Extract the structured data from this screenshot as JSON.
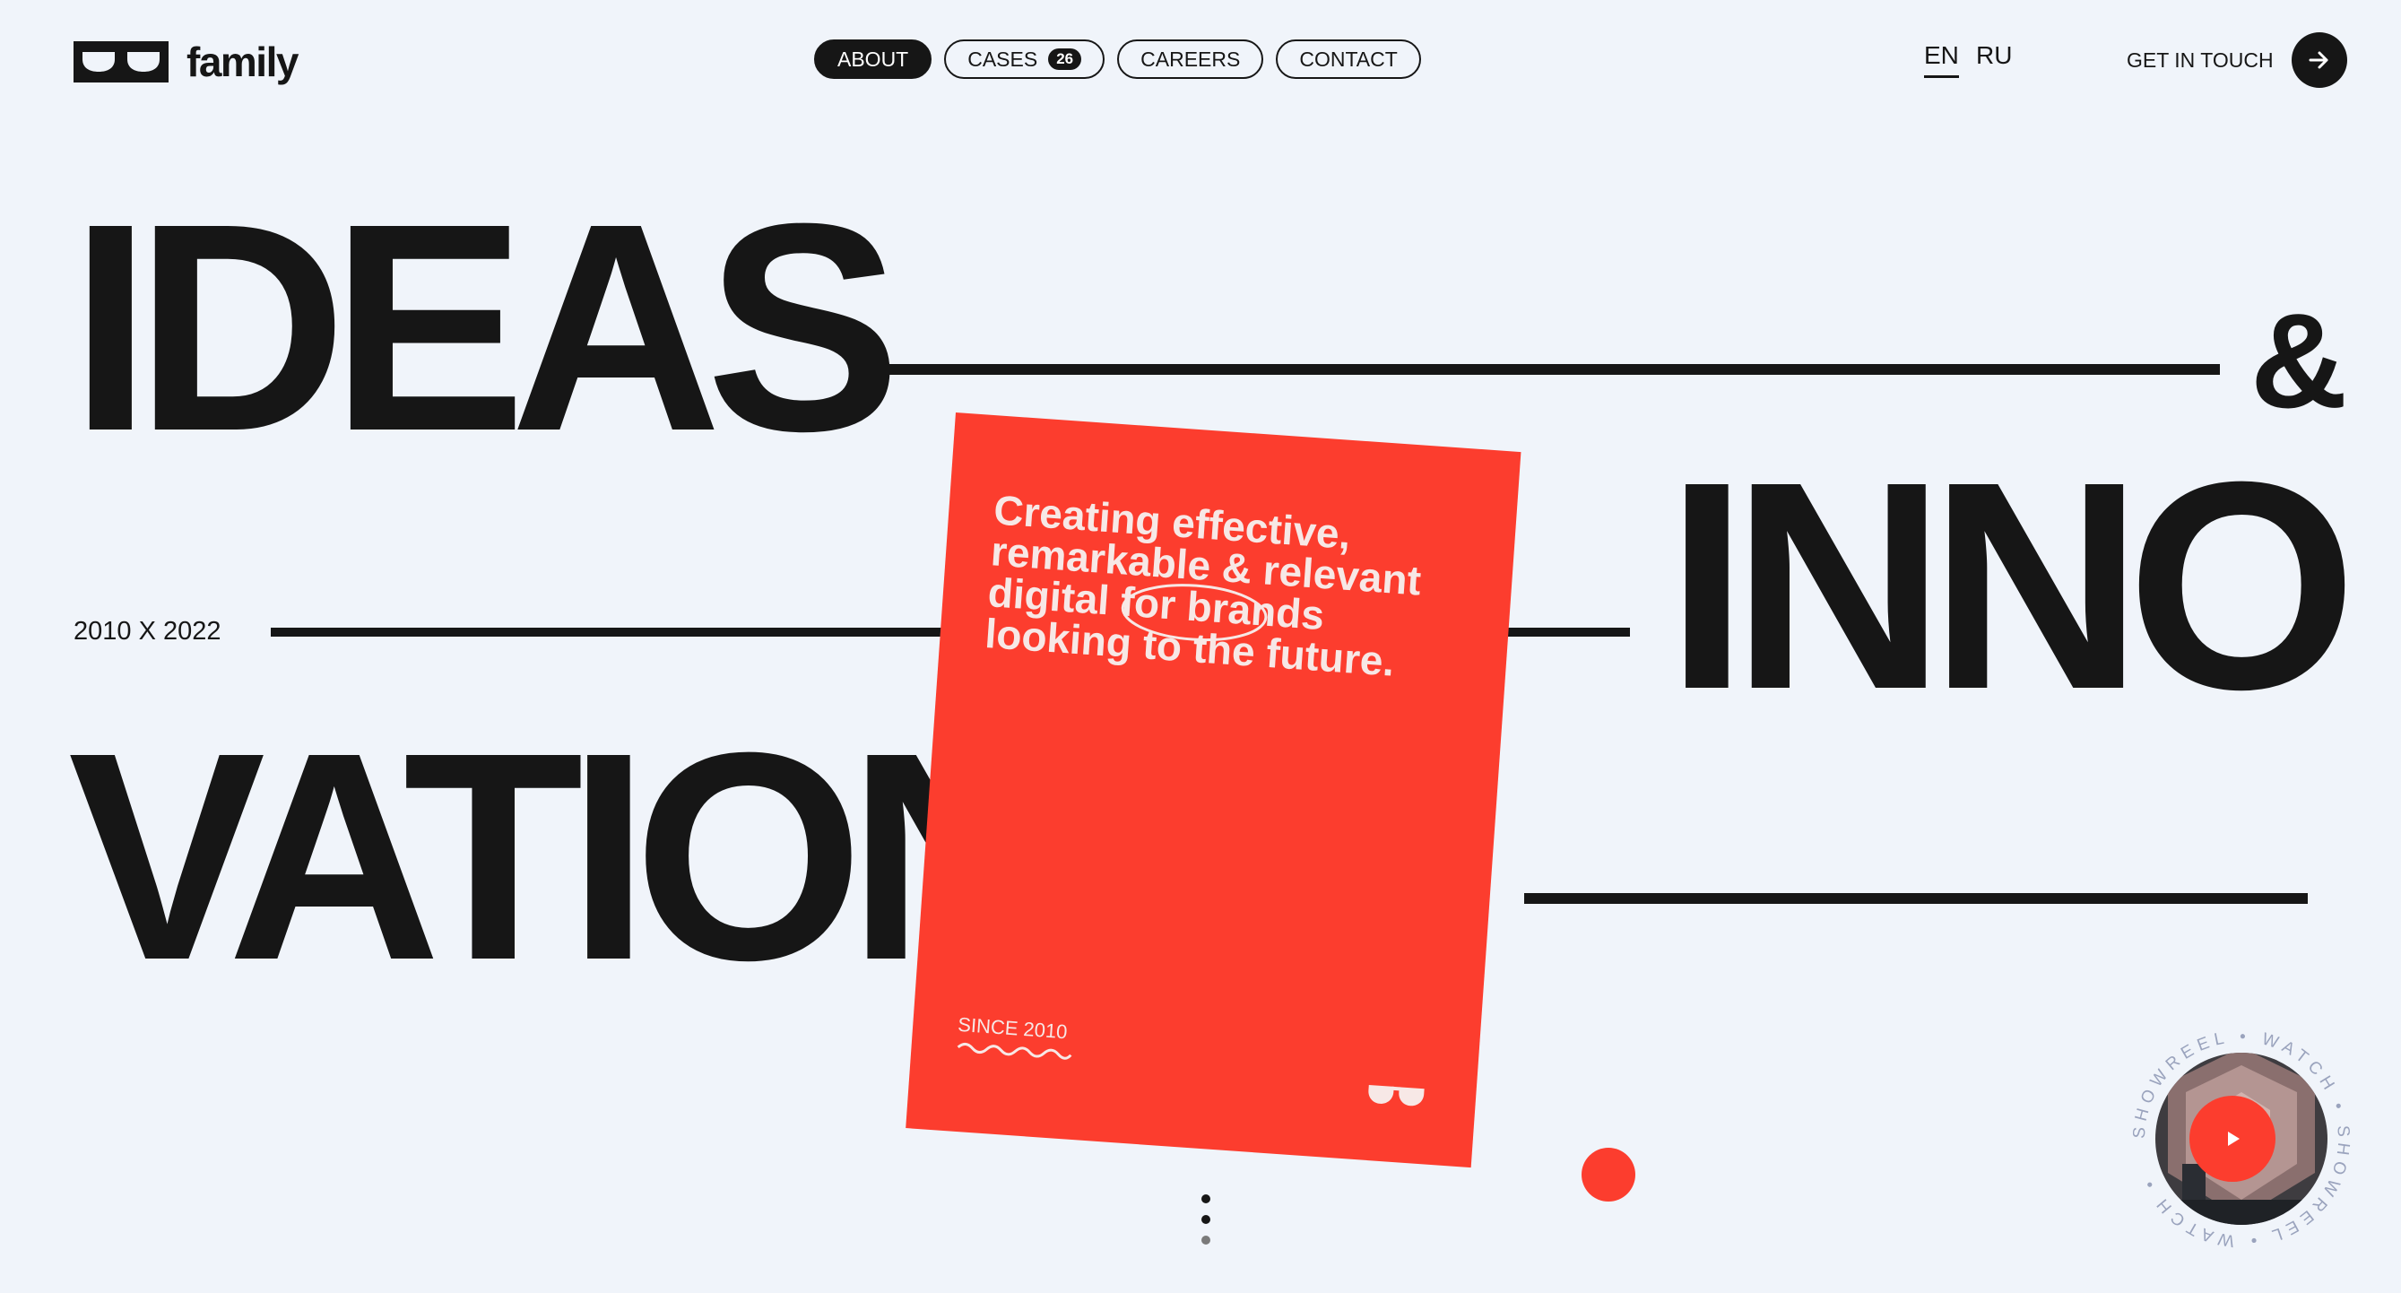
{
  "brand": {
    "name": "family"
  },
  "nav": [
    {
      "label": "ABOUT"
    },
    {
      "label": "CASES",
      "badge": "26"
    },
    {
      "label": "CAREERS"
    },
    {
      "label": "CONTACT"
    }
  ],
  "lang": {
    "en": "EN",
    "ru": "RU",
    "active": "EN"
  },
  "cta": {
    "label": "GET IN TOUCH"
  },
  "hero": {
    "word1": "IDEAS",
    "amp": "&",
    "word2": "INNO",
    "word3": "VATION",
    "years": "2010 X 2022"
  },
  "card": {
    "text": "Creating effective, remarkable & relevant digital for brands looking to the future.",
    "since": "SINCE 2010"
  },
  "showreel": {
    "ring_text": "SHOWREEL • WATCH • SHOWREEL • WATCH • "
  },
  "colors": {
    "accent": "#fc3d2e",
    "ink": "#161616",
    "background": "#f0f4fa"
  }
}
